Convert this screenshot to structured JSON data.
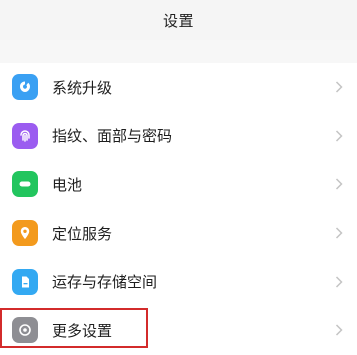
{
  "header": {
    "title": "设置"
  },
  "items": [
    {
      "label": "系统升级",
      "icon": "system-update-icon",
      "color": "#3aa0f3"
    },
    {
      "label": "指纹、面部与密码",
      "icon": "fingerprint-icon",
      "color": "#9b5cf0"
    },
    {
      "label": "电池",
      "icon": "battery-icon",
      "color": "#22c55e"
    },
    {
      "label": "定位服务",
      "icon": "location-icon",
      "color": "#f39a1d"
    },
    {
      "label": "运存与存储空间",
      "icon": "storage-icon",
      "color": "#33a9f2"
    },
    {
      "label": "更多设置",
      "icon": "gear-icon",
      "color": "#8e8e93"
    }
  ],
  "highlight": {
    "target": "更多设置",
    "color": "#d32b2b"
  }
}
